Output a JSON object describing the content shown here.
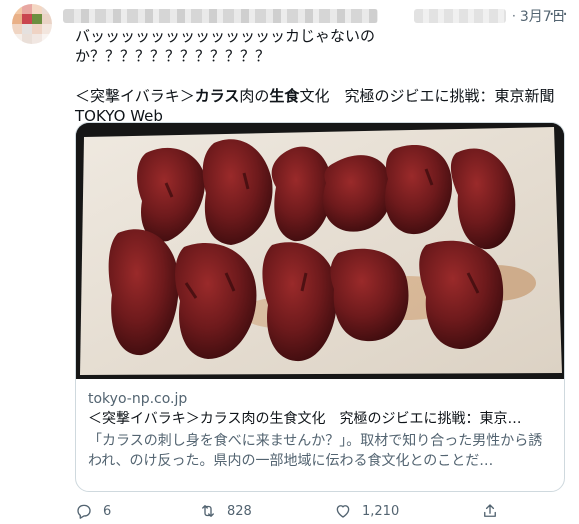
{
  "tweet": {
    "date": "3月7日",
    "dot": "·",
    "more": "···",
    "text_line1": "バッッッッッッッッッッッッッカじゃないのか？？？？？？？？？？？？",
    "headline_prefix": "＜突撃イバラキ＞",
    "headline_bold1": "カラス",
    "headline_mid1": "肉の",
    "headline_bold2": "生食",
    "headline_rest": "文化　究極のジビエに挑戦：東京新聞",
    "headline_line2": "TOKYO Web"
  },
  "card": {
    "domain": "tokyo-np.co.jp",
    "title": "＜突撃イバラキ＞カラス肉の生食文化　究極のジビエに挑戦：東京…",
    "description": "「カラスの刺し身を食べに来ませんか？」。取材で知り合った男性から誘われ、のけ反った。県内の一部地域に伝わる食文化とのことだ…"
  },
  "actions": {
    "replies": "6",
    "retweets": "828",
    "likes": "1,210"
  },
  "colors": {
    "text": "#0f1419",
    "secondary": "#536471",
    "border": "#cfd9de",
    "meat": "#6e1a1c"
  }
}
